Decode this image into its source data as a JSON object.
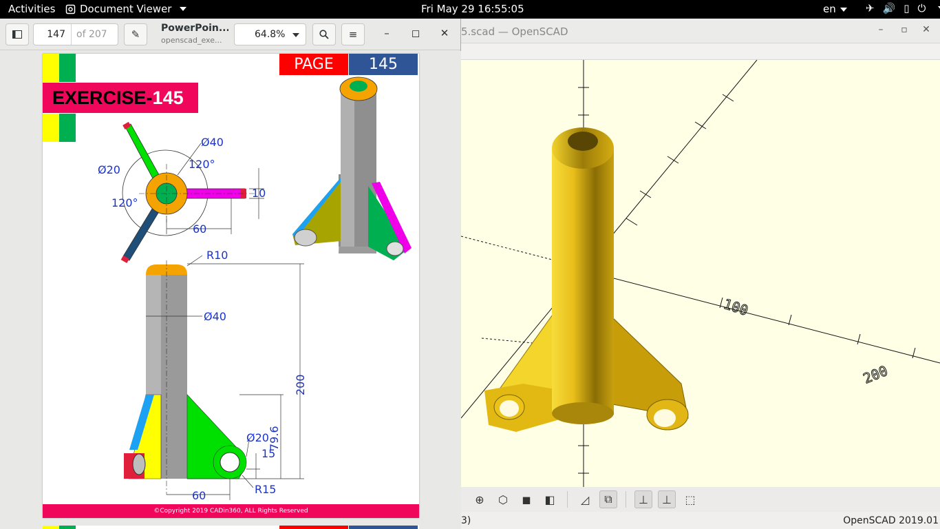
{
  "topbar": {
    "activities": "Activities",
    "app_menu": "Document Viewer",
    "clock": "Fri May 29  16:55:05",
    "language": "en",
    "tray_icons": [
      "airplane-icon",
      "volume-icon",
      "battery-icon",
      "power-icon"
    ]
  },
  "openscad": {
    "title": "5.scad — OpenSCAD",
    "status_left": "3)",
    "status_right": "OpenSCAD 2019.01",
    "axis_labels": [
      "100",
      "200"
    ],
    "toolbar_icons": [
      "view-right-icon",
      "view-top-icon",
      "view-front-icon",
      "view-back-icon",
      "perspective-icon",
      "orthogonal-icon",
      "axes-icon",
      "scale-markers-icon",
      "edges-icon"
    ]
  },
  "docviewer": {
    "page_current": "147",
    "page_total": "of 207",
    "title": "PowerPoin...",
    "subtitle": "openscad_exe...",
    "zoom": "64.8%"
  },
  "exercise": {
    "page_label": "PAGE",
    "page_number": "145",
    "banner_prefix": "EXERCISE-",
    "banner_number": "145",
    "footer": "©Copyright 2019 CADin360, ALL Rights Reserved",
    "dims": {
      "d40_top": "Ø40",
      "d20_top": "Ø20",
      "ang1": "120°",
      "ang2": "120°",
      "w10": "10",
      "l60_top": "60",
      "r10": "R10",
      "d40_front": "Ø40",
      "h200": "200",
      "h79": "79.6",
      "d20_front": "Ø20",
      "d15": "15",
      "r15": "R15",
      "l60_front": "60"
    }
  },
  "colors": {
    "banner": "#f0065a",
    "page_red": "#ff0000",
    "page_blue": "#2f5597",
    "model_yellow": "#f2c81c",
    "viewport_bg": "#ffffe6"
  }
}
